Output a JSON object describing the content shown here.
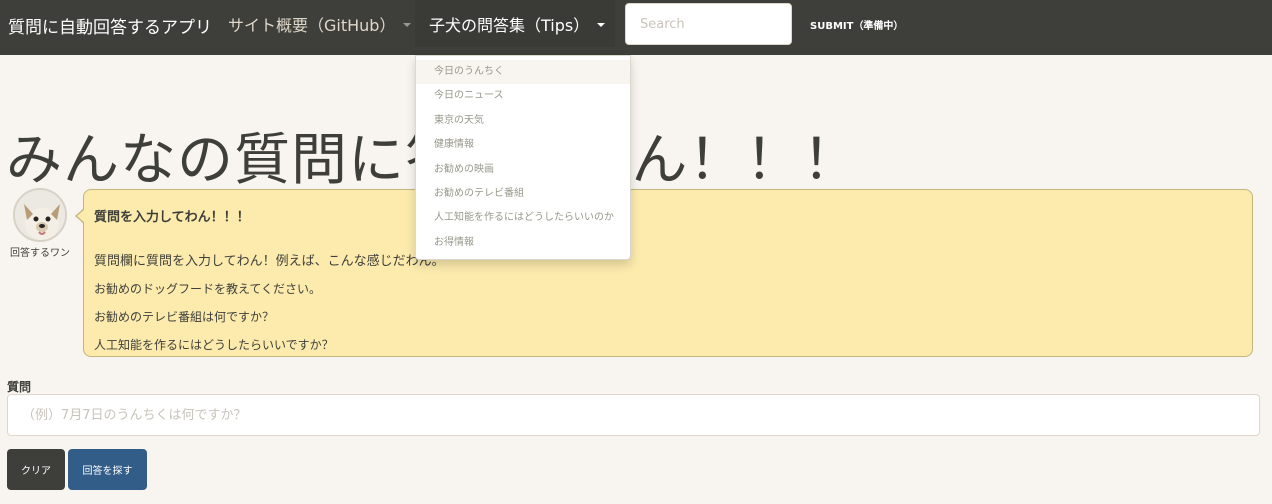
{
  "navbar": {
    "brand": "質問に自動回答するアプリ",
    "github_label": "サイト概要（GitHub）",
    "tips_label": "子犬の問答集（Tips）",
    "search_placeholder": "Search",
    "submit_label": "SUBMIT（準備中）"
  },
  "dropdown": {
    "items": [
      "今日のうんちく",
      "今日のニュース",
      "東京の天気",
      "健康情報",
      "お勧めの映画",
      "お勧めのテレビ番組",
      "人工知能を作るにはどうしたらいいのか",
      "お得情報"
    ]
  },
  "main": {
    "page_title": "みんなの質問に答えるわん！！！",
    "avatar_name": "回答するワン"
  },
  "bubble": {
    "title": "質問を入力してわん！！！",
    "intro": "質問欄に質問を入力してわん！例えば、こんな感じだわん。",
    "examples": [
      "お勧めのドッグフードを教えてください。",
      "お勧めのテレビ番組は何ですか？",
      "人工知能を作るにはどうしたらいいですか？"
    ]
  },
  "form": {
    "label": "質問",
    "placeholder": "（例）7月7日のうんちくは何ですか？",
    "clear_label": "クリア",
    "search_label": "回答を探す"
  },
  "colors": {
    "navbar": "#3e3f3a",
    "page_bg": "#f8f5f0",
    "bubble_bg": "#fcebad",
    "primary": "#325d88"
  }
}
